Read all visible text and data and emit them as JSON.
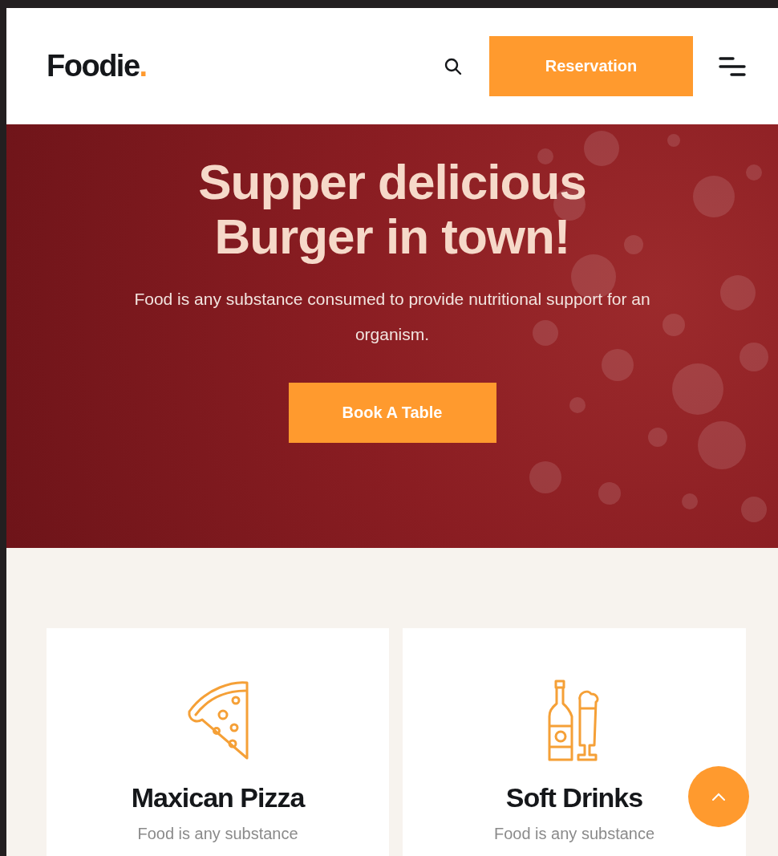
{
  "header": {
    "logo": "Foodie",
    "logo_dot": ".",
    "reservation_button": "Reservation"
  },
  "hero": {
    "title_lines": [
      "Supper delicious",
      "Burger in town!"
    ],
    "description": "Food is any substance consumed to provide nutritional support for an organism.",
    "button": "Book A Table"
  },
  "cards": [
    {
      "kind": "pizza",
      "title": "Maxican Pizza",
      "text": "Food is any substance"
    },
    {
      "kind": "drinks",
      "title": "Soft Drinks",
      "text": "Food is any substance"
    }
  ]
}
